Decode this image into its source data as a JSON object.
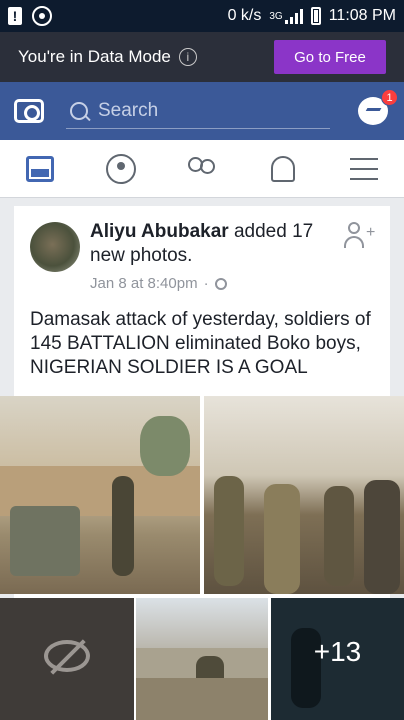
{
  "status_bar": {
    "net_speed": "0 k/s",
    "network_type": "3G",
    "time": "11:08 PM"
  },
  "data_mode": {
    "message": "You're in Data Mode",
    "button_label": "Go to Free",
    "button_color": "#8b35c8"
  },
  "header": {
    "search_placeholder": "Search",
    "messenger_badge": "1",
    "brand_color": "#3b5998"
  },
  "tabs": [
    "news-feed",
    "groups",
    "friends",
    "notifications",
    "menu"
  ],
  "post": {
    "author": "Aliyu Abubakar",
    "action": "added 17 new photos.",
    "timestamp": "Jan 8 at 8:40pm",
    "visibility_icon": "globe-icon",
    "text": "Damasak attack of yesterday, soldiers of 145 BATTALION eliminated Boko boys, NIGERIAN SOLDIER IS A GOAL",
    "more_photos": "+13"
  }
}
